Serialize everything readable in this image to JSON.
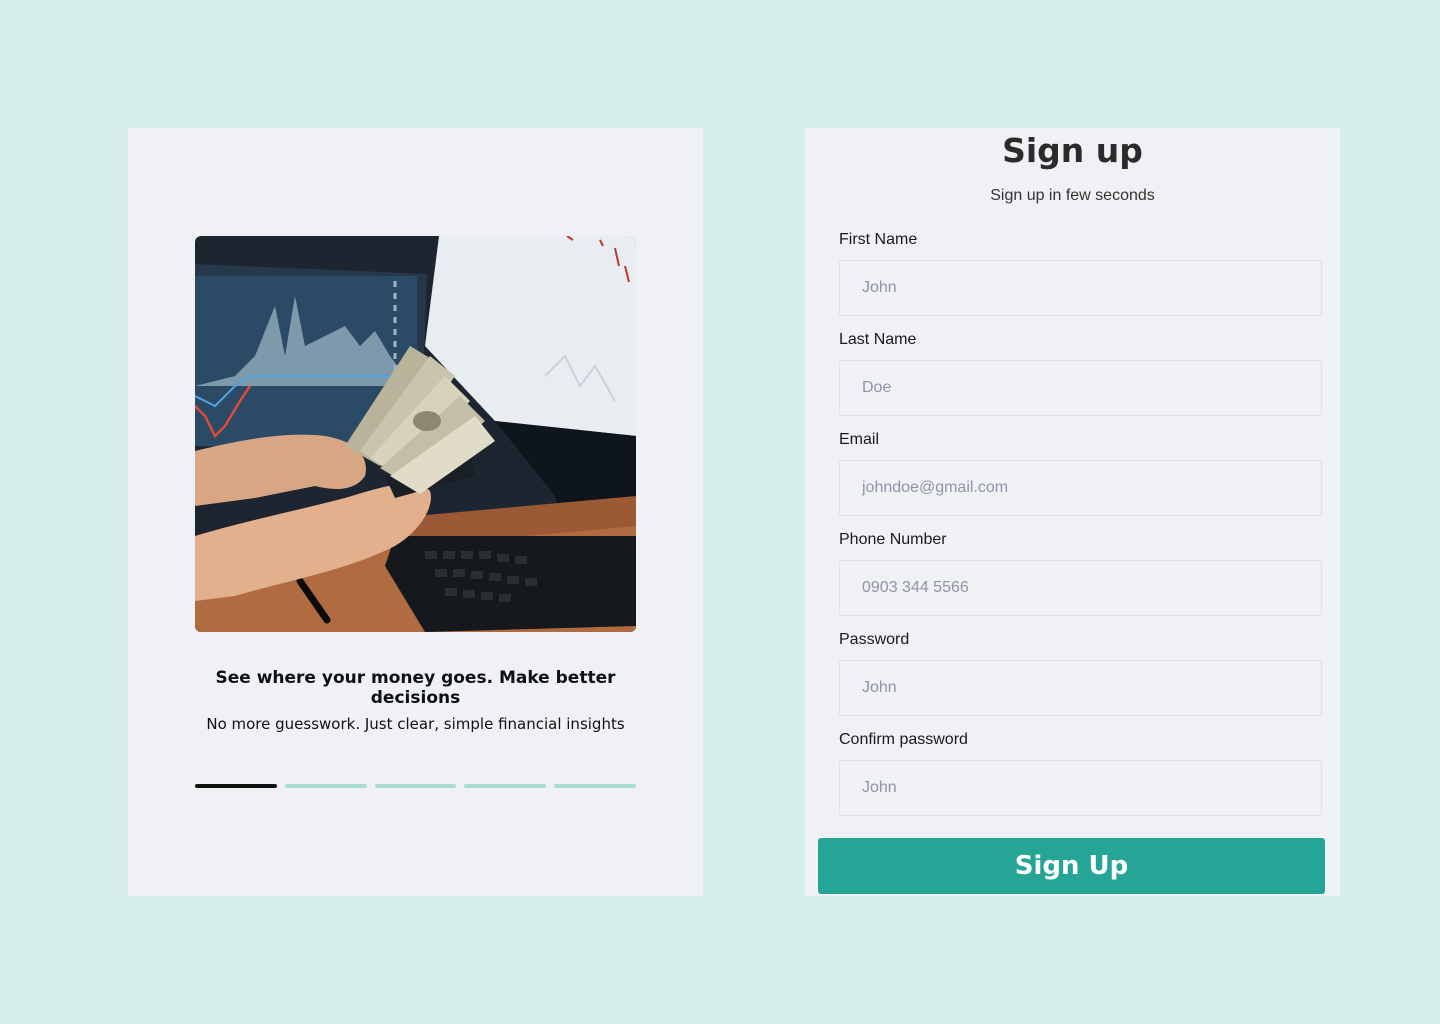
{
  "onboarding": {
    "title": "See where your money goes. Make better decisions",
    "subtitle": "No more guesswork. Just clear, simple financial insights",
    "slides_total": 5,
    "active_slide": 1,
    "hero_image": "hands-counting-cash-at-trading-desk"
  },
  "signup": {
    "title": "Sign up",
    "subtitle": "Sign up in few seconds",
    "fields": [
      {
        "label": "First Name",
        "placeholder": "John"
      },
      {
        "label": "Last Name",
        "placeholder": "Doe"
      },
      {
        "label": "Email",
        "placeholder": "johndoe@gmail.com"
      },
      {
        "label": "Phone Number",
        "placeholder": "0903 344 5566"
      },
      {
        "label": "Password",
        "placeholder": "John"
      },
      {
        "label": "Confirm password",
        "placeholder": "John"
      }
    ],
    "submit_label": "Sign Up"
  },
  "colors": {
    "background": "#d5efeb",
    "panel": "#f0f1f5",
    "accent": "#25a596",
    "pager_inactive": "#a8ded2",
    "pager_active": "#0d1210"
  }
}
